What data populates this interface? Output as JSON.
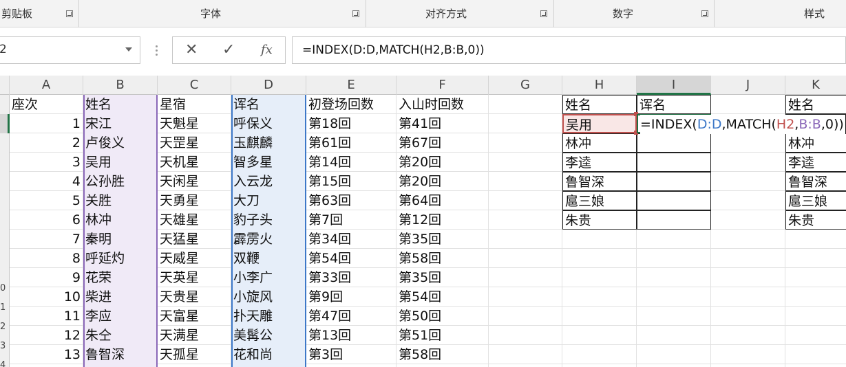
{
  "ribbon": {
    "groups": [
      {
        "label": "剪贴板"
      },
      {
        "label": "字体"
      },
      {
        "label": "对齐方式"
      },
      {
        "label": "数字"
      },
      {
        "label": "样式"
      }
    ]
  },
  "formula_bar": {
    "name_box": "2",
    "cancel_symbol": "✕",
    "enter_symbol": "✓",
    "fx_label": "fx",
    "formula": "=INDEX(D:D,MATCH(H2,B:B,0))"
  },
  "grid": {
    "columns": [
      "A",
      "B",
      "C",
      "D",
      "E",
      "F",
      "G",
      "H",
      "I",
      "J",
      "K"
    ],
    "row_labels": [
      "",
      "",
      "",
      "",
      "",
      "",
      "",
      "",
      "",
      "0",
      "1",
      "2",
      "3",
      "4"
    ],
    "headers": {
      "A": "座次",
      "B": "姓名",
      "C": "星宿",
      "D": "诨名",
      "E": "初登场回数",
      "F": "入山时回数"
    },
    "rows": [
      {
        "a": "1",
        "b": "宋江",
        "c": "天魁星",
        "d": "呼保义",
        "e": "第18回",
        "f": "第41回"
      },
      {
        "a": "2",
        "b": "卢俊义",
        "c": "天罡星",
        "d": "玉麒麟",
        "e": "第61回",
        "f": "第67回"
      },
      {
        "a": "3",
        "b": "吴用",
        "c": "天机星",
        "d": "智多星",
        "e": "第14回",
        "f": "第20回"
      },
      {
        "a": "4",
        "b": "公孙胜",
        "c": "天闲星",
        "d": "入云龙",
        "e": "第15回",
        "f": "第20回"
      },
      {
        "a": "5",
        "b": "关胜",
        "c": "天勇星",
        "d": "大刀",
        "e": "第63回",
        "f": "第64回"
      },
      {
        "a": "6",
        "b": "林冲",
        "c": "天雄星",
        "d": "豹子头",
        "e": "第7回",
        "f": "第12回"
      },
      {
        "a": "7",
        "b": "秦明",
        "c": "天猛星",
        "d": "霹雳火",
        "e": "第34回",
        "f": "第35回"
      },
      {
        "a": "8",
        "b": "呼延灼",
        "c": "天威星",
        "d": "双鞭",
        "e": "第54回",
        "f": "第58回"
      },
      {
        "a": "9",
        "b": "花荣",
        "c": "天英星",
        "d": "小李广",
        "e": "第33回",
        "f": "第35回"
      },
      {
        "a": "10",
        "b": "柴进",
        "c": "天贵星",
        "d": "小旋风",
        "e": "第9回",
        "f": "第54回"
      },
      {
        "a": "11",
        "b": "李应",
        "c": "天富星",
        "d": "扑天雕",
        "e": "第47回",
        "f": "第50回"
      },
      {
        "a": "12",
        "b": "朱仝",
        "c": "天满星",
        "d": "美髯公",
        "e": "第13回",
        "f": "第51回"
      },
      {
        "a": "13",
        "b": "鲁智深",
        "c": "天孤星",
        "d": "花和尚",
        "e": "第3回",
        "f": "第58回"
      }
    ],
    "lookup": {
      "h_header": "姓名",
      "i_header": "诨名",
      "names": [
        "吴用",
        "林冲",
        "李逵",
        "鲁智深",
        "扈三娘",
        "朱贵"
      ],
      "editing_formula_parts": [
        {
          "text": "=INDEX(",
          "color": "#111111"
        },
        {
          "text": "D:D",
          "color": "#3d78c8"
        },
        {
          "text": ",MATCH(",
          "color": "#111111"
        },
        {
          "text": "H2",
          "color": "#c0504d"
        },
        {
          "text": ",",
          "color": "#111111"
        },
        {
          "text": "B:B",
          "color": "#8a67b8"
        },
        {
          "text": ",0))",
          "color": "#111111"
        }
      ]
    },
    "k_column": {
      "header": "姓名",
      "names": [
        "",
        "林冲",
        "李逵",
        "鲁智深",
        "扈三娘",
        "朱贵"
      ]
    }
  }
}
